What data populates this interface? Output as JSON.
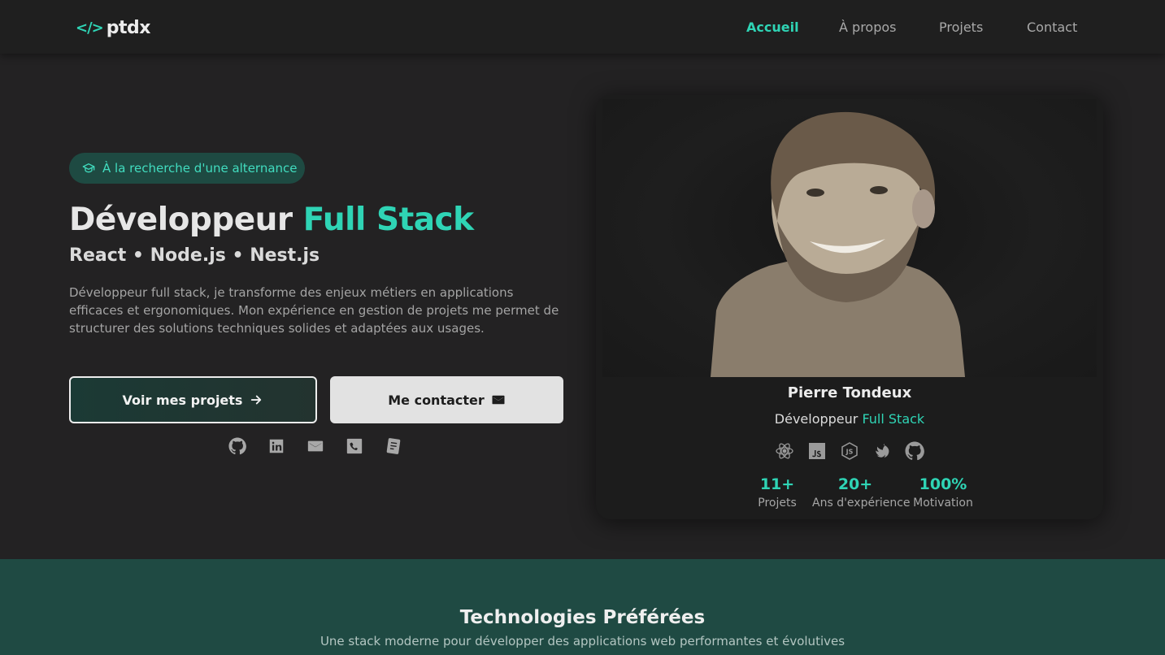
{
  "nav": {
    "logo_mark": "</>",
    "logo_text": "ptdx",
    "links": [
      {
        "label": "Accueil",
        "active": true
      },
      {
        "label": "À propos",
        "active": false
      },
      {
        "label": "Projets",
        "active": false
      },
      {
        "label": "Contact",
        "active": false
      }
    ]
  },
  "hero": {
    "badge": "À la recherche d'une alternance",
    "title_main": "Développeur ",
    "title_accent": "Full Stack",
    "stack": "React • Node.js • Nest.js",
    "description": "Développeur full stack, je transforme des enjeux métiers en applications efficaces et ergonomiques. Mon expérience en gestion de projets me permet de structurer des solutions techniques solides et adaptées aux usages.",
    "primary_button": "Voir mes projets",
    "secondary_button": "Me contacter",
    "socials": [
      "github-icon",
      "linkedin-icon",
      "mail-icon",
      "phone-icon",
      "document-icon"
    ]
  },
  "card": {
    "name": "Pierre Tondeux",
    "role_main": "Développeur ",
    "role_accent": "Full Stack",
    "tech_icons": [
      "react-icon",
      "javascript-icon",
      "nodejs-icon",
      "nestjs-icon",
      "github-icon"
    ],
    "stats": [
      {
        "value": "11+",
        "label": "Projets"
      },
      {
        "value": "20+",
        "label": "Ans d'expérience"
      },
      {
        "value": "100%",
        "label": "Motivation"
      }
    ]
  },
  "tech_section": {
    "title": "Technologies Préférées",
    "subtitle": "Une stack moderne pour développer des applications web performantes et évolutives"
  },
  "colors": {
    "accent": "#2fd4b5",
    "background": "#232223",
    "section_bg": "#1f4a43"
  }
}
